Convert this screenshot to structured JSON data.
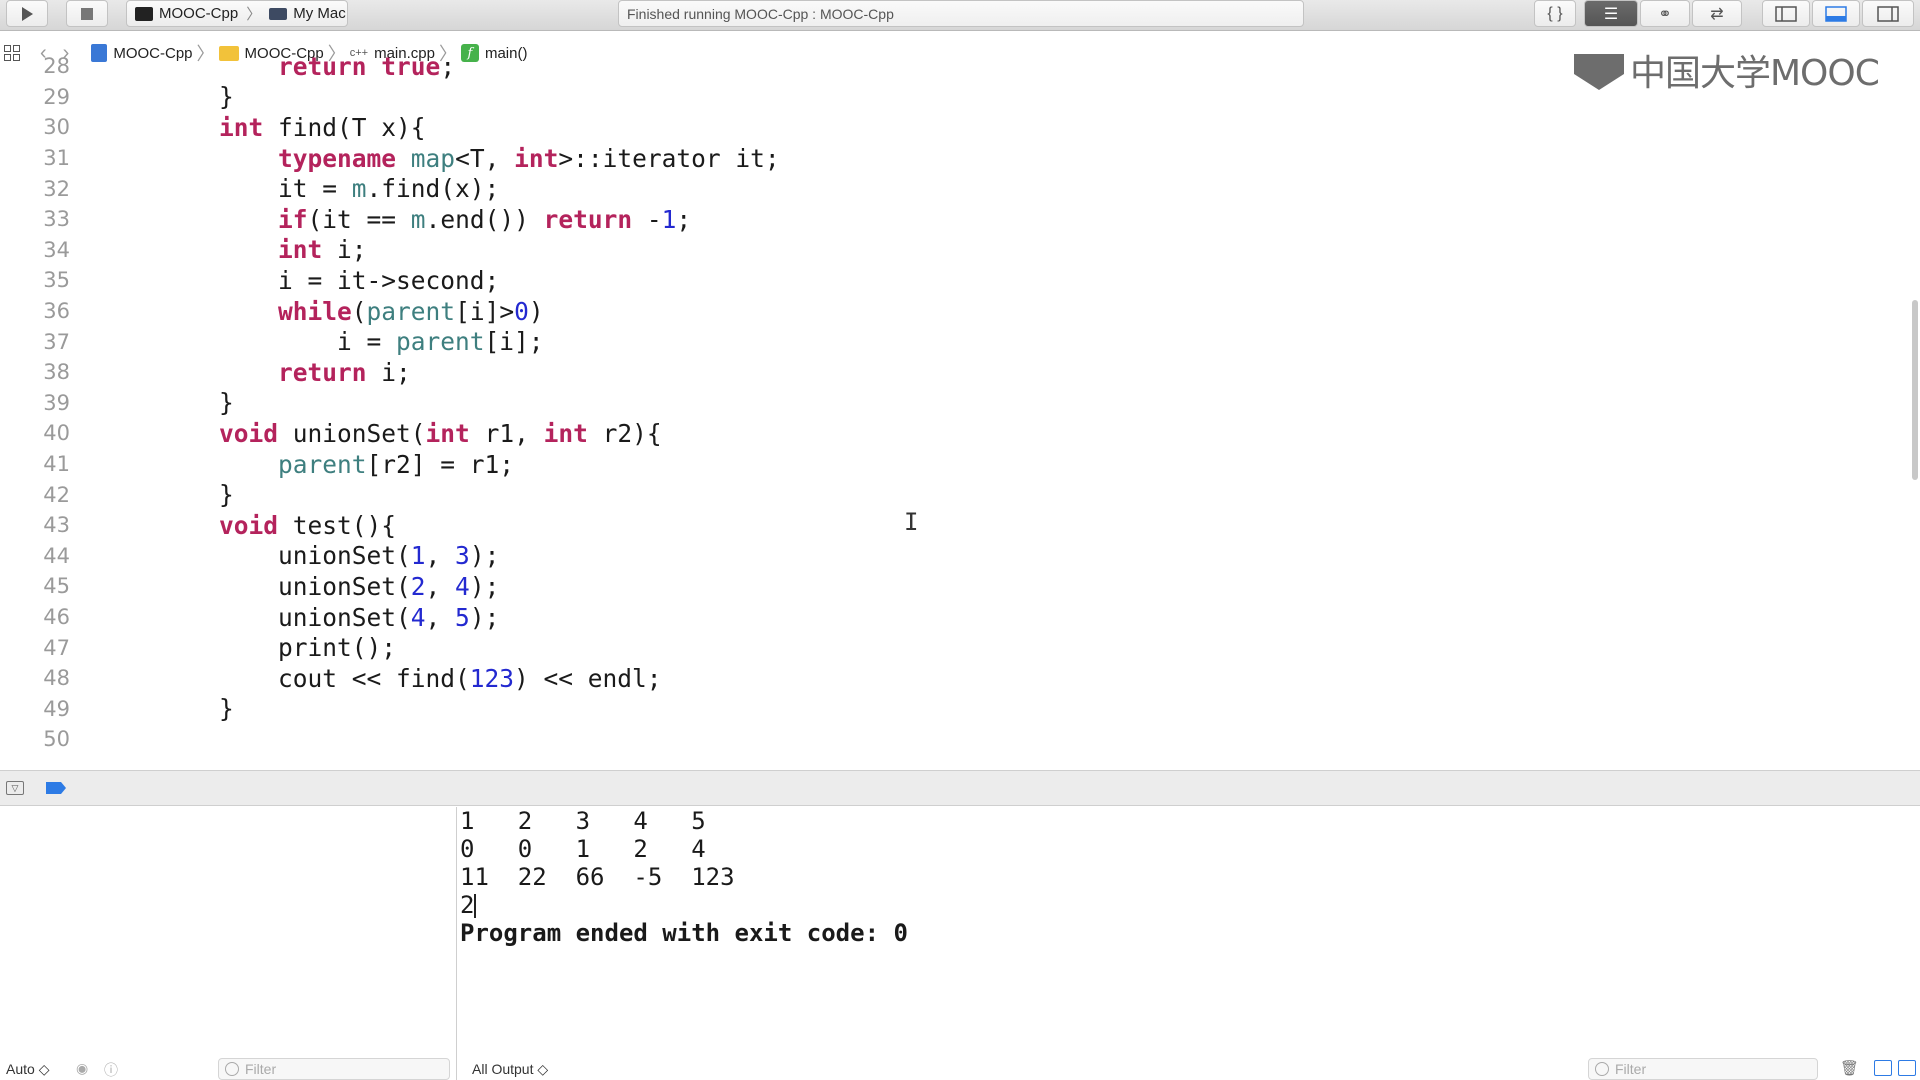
{
  "toolbar": {
    "scheme": "MOOC-Cpp",
    "destination": "My Mac",
    "status": "Finished running MOOC-Cpp : MOOC-Cpp",
    "icons": [
      "run-icon",
      "stop-icon",
      "braces-icon",
      "standard-editor-icon",
      "assistant-editor-icon",
      "version-editor-icon",
      "navigator-toggle-icon",
      "debug-area-toggle-icon",
      "utilities-toggle-icon"
    ]
  },
  "jumpbar": {
    "crumbs": [
      "MOOC-Cpp",
      "MOOC-Cpp",
      "main.cpp",
      "main()"
    ],
    "cpp_badge": "c++",
    "func_badge": "f"
  },
  "watermark": "中国大学MOOC",
  "editor": {
    "lines": [
      {
        "n": "28",
        "code": "        return true;"
      },
      {
        "n": "29",
        "code": "    }"
      },
      {
        "n": "30",
        "code": "    int find(T x){"
      },
      {
        "n": "31",
        "code": "        typename map<T, int>::iterator it;"
      },
      {
        "n": "32",
        "code": "        it = m.find(x);"
      },
      {
        "n": "33",
        "code": "        if(it == m.end()) return -1;"
      },
      {
        "n": "34",
        "code": "        int i;"
      },
      {
        "n": "35",
        "code": "        i = it->second;"
      },
      {
        "n": "36",
        "code": "        while(parent[i]>0)"
      },
      {
        "n": "37",
        "code": "            i = parent[i];"
      },
      {
        "n": "38",
        "code": "        return i;"
      },
      {
        "n": "39",
        "code": "    }"
      },
      {
        "n": "40",
        "code": "    void unionSet(int r1, int r2){"
      },
      {
        "n": "41",
        "code": "        parent[r2] = r1;"
      },
      {
        "n": "42",
        "code": "    }"
      },
      {
        "n": "43",
        "code": "    void test(){"
      },
      {
        "n": "44",
        "code": "        unionSet(1, 3);"
      },
      {
        "n": "45",
        "code": "        unionSet(2, 4);"
      },
      {
        "n": "46",
        "code": "        unionSet(4, 5);"
      },
      {
        "n": "47",
        "code": "        print();"
      },
      {
        "n": "48",
        "code": "        cout << find(123) << endl;"
      },
      {
        "n": "49",
        "code": "    }"
      },
      {
        "n": "50",
        "code": ""
      }
    ]
  },
  "console": {
    "lines": [
      "1   2   3   4   5",
      "0   0   1   2   4",
      "11  22  66  -5  123",
      "2",
      "Program ended with exit code: 0"
    ]
  },
  "statusbar": {
    "variables_mode": "Auto ◇",
    "filter_placeholder": "Filter",
    "output_mode": "All Output ◇"
  },
  "colors": {
    "keyword": "#b4235c",
    "type": "#3e7f7f",
    "number": "#2329d0",
    "accent": "#2d7be5"
  }
}
